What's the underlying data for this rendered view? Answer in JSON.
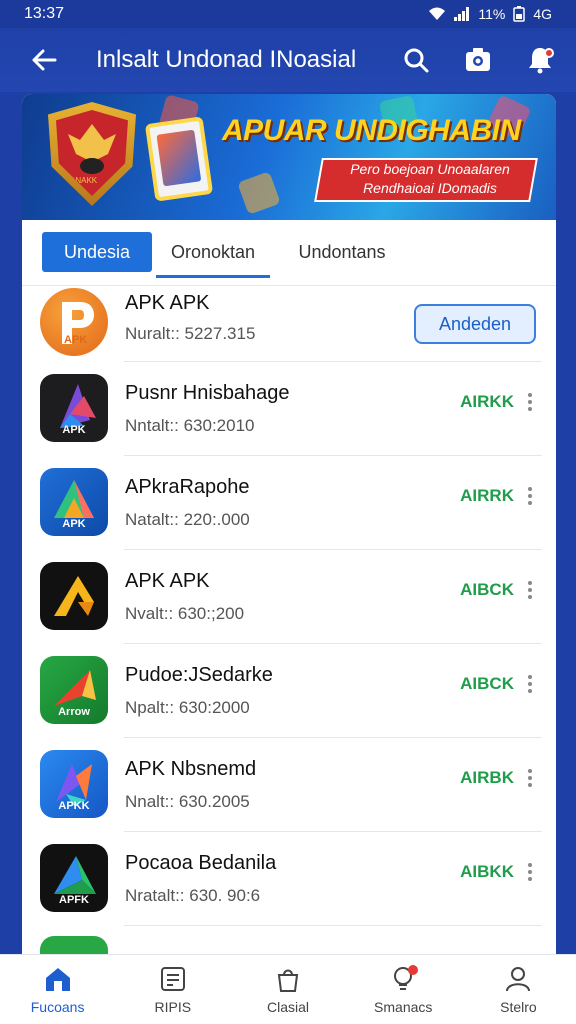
{
  "status_bar": {
    "time": "13:37",
    "right_text": "11%",
    "network_text": "4G"
  },
  "app_bar": {
    "title": "Inlsalt Undonad INoasial"
  },
  "banner": {
    "headline": "APUAR UNDIGHABIN",
    "subtext": "Pero boejoan Unoaalaren Rendhaioai IDomadis",
    "seal_text": "ANAKK"
  },
  "tabs": [
    {
      "label": "Undesia"
    },
    {
      "label": "Oronoktan"
    },
    {
      "label": "Undontans"
    }
  ],
  "apps": [
    {
      "name": "APK APK",
      "meta": "Nuralt:: 5227.315",
      "action": "Andeden",
      "icon_text": "APK"
    },
    {
      "name": "Pusnr Hnisbahage",
      "meta": "Nntalt:: 630:2010",
      "action": "AIRKK",
      "icon_text": "APK"
    },
    {
      "name": "APkraRapohe",
      "meta": "Natalt:: 220:.000",
      "action": "AIRRK",
      "icon_text": "APK"
    },
    {
      "name": "APK APK",
      "meta": "Nvalt:: 630:;200",
      "action": "AIBCK",
      "icon_text": ""
    },
    {
      "name": "Pudoe:JSedarke",
      "meta": "Npalt:: 630:2000",
      "action": "AIBCK",
      "icon_text": "Arrow"
    },
    {
      "name": "APK Nbsnemd",
      "meta": "Nnalt:: 630.2005",
      "action": "AIRBK",
      "icon_text": "APKK"
    },
    {
      "name": "Pocaoa Bedanila",
      "meta": "Nratalt:: 630. 90:6",
      "action": "AIBKK",
      "icon_text": "APFK"
    }
  ],
  "bottom_nav": [
    {
      "label": "Fucoans",
      "icon": "home-icon"
    },
    {
      "label": "RIPIS",
      "icon": "list-icon"
    },
    {
      "label": "Clasial",
      "icon": "bag-icon"
    },
    {
      "label": "Smanacs",
      "icon": "bulb-icon"
    },
    {
      "label": "Stelro",
      "icon": "person-icon"
    }
  ],
  "colors": {
    "primary": "#1e6fd9",
    "app_bar": "#1f41a8",
    "status_green": "#1f9d4a"
  }
}
